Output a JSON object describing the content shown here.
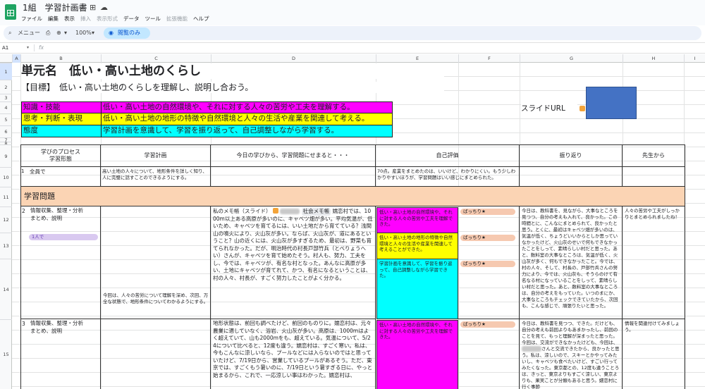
{
  "app": {
    "doc_title": "1組　学習計画書",
    "menus": [
      "ファイル",
      "編集",
      "表示",
      "挿入",
      "表示形式",
      "データ",
      "ツール",
      "拡張機能",
      "ヘルプ"
    ],
    "disabled_menus": [
      3,
      4,
      7
    ],
    "toolbar": {
      "menu_label": "メニュー",
      "zoom": "100%",
      "view_only": "閲覧のみ"
    },
    "cell_ref": "A1",
    "fx": "fx"
  },
  "columns": [
    "A",
    "B",
    "C",
    "D",
    "E",
    "F",
    "G",
    "H",
    "I"
  ],
  "rows": [
    "1",
    "2",
    "3",
    "4",
    "5",
    "6",
    "7",
    "8",
    "9",
    "10",
    "11",
    "12",
    "13",
    "14",
    "15"
  ],
  "sheet": {
    "unit_title": "単元名　低い・高い土地のくらし",
    "goal": "【目標】　低い・高い土地のくらしを理解し、説明し合おう。",
    "objectives": [
      {
        "label": "知識・技能",
        "text": "低い・高い土地の自然環境や、それに対する人々の苦労や工夫を理解する。",
        "color": "#ff00ff"
      },
      {
        "label": "思考・判断・表現",
        "text": "低い・高い土地の地形の特徴や自然環境と人々の生活や産業を関連して考える。",
        "color": "#ffff00"
      },
      {
        "label": "態度",
        "text": "学習計画を意識して、学習を振り返って、自己調整しながら学習する。",
        "color": "#00ffff"
      }
    ],
    "slide_url_label": "スライドURL",
    "headers": {
      "process": "学びのプロセス\n学習形態",
      "plan": "学習計画",
      "summary": "今日の学びから、学習問題にせまると・・・",
      "self_eval": "自己評価",
      "reflection": "振り返り",
      "teacher": "先生から"
    },
    "row10": {
      "process": "全員で",
      "plan": "高い土地の人々について、地形条件を詳しく知り、人に完璧に話すことのできるようにする。",
      "self_eval": "70点。産業をまとめたのは、いいけど、わかりにくい。もう少しわかりやすいほうが、学習問題はいい感じにまとめられた。"
    },
    "section_title": "学習問題",
    "row12": {
      "number": "2",
      "process": "情報収集、整理・分析\nまとめ、説明",
      "chip": "1人で",
      "plan_bottom": "今回は、人々の苦労について理解を深め、次回、万全な状態で、地形条件についてわかるようにする。",
      "memo_prefix": "私のメモ帳（スライド）",
      "memo_chip": "社会メモ帳",
      "memo_text": "嬬恋村では、1000m以上ある高原が多いのに、キャベツ畑が多い。平均気温が、低いため、キャベツを育てるには、いい土地だから育てている？浅間山の噴火により、火山灰が多い。ならば、火山灰が、道にあるということ？山の近くには、火山灰が多すぎるため、最初は、野菜も育てられなかった。だが、明治時代の村長戸部竹兵（とべりょうへい）さんが、キャベツを育て始めたそう。村人も、努力、工夫をし、今では、キャベツが、有名な村となった。あんなに高原が多い、土地にキャベツが育てれて、かつ、有名になるということは、村の人々、村長が、すごく努力したことがよく分かる。",
      "evals": [
        {
          "text": "低い・高い土地の自然環境や、それに対する人々の苦労や工夫を理解できた。",
          "color": "#ff00ff",
          "badge": "ばっちり★"
        },
        {
          "text": "低い・高い土地の地形の特徴や自然環境と人々の生活や産業を関連して考えることができた。",
          "color": "#ffff00",
          "badge": "ばっちり★"
        },
        {
          "text": "学習計画を意識して、学習を振り返って、自己調整しながら学習できた。",
          "color": "#00ffff",
          "badge": "ばっちり★"
        }
      ],
      "reflection": "今日は、教科書を、見ながら、大事なところを見つつ、自分の考えも入れて、良かった。この時間とに、こんなにまとめられて、良かったと思う。とくに、最初はキャベツ畑が多いのは、気温が低く、ちょうどいいからとしか思っていなかったけど、火山灰のせいで何もできなかったことをしって、素晴らしい村だと思った。あと、数料室の大事なところは、気温が低く、火山灰が多く、何もできなかったこと。今では、村の人々、そして、村長の、戸部竹兵さんの努力により、今では、火山灰も、そうらのけて有名なる村になっていることをしって、素晴らしい村だと思った。あと、数料室の大事なところは、自分の考えをもっていた。いつのまにか、大事なところもチェックできていたから、次回も、こんな感じで、頑張りたいと思った。",
      "teacher": "人々の苦労や工夫がしっかりとまとめられましたね！"
    },
    "row15": {
      "number": "3",
      "process": "情報収集、整理・分析\nまとめ、説明",
      "memo_text": "地形状態は、前回も調べたけど、前回のものりに。嬬恋村は、元々農業に適していなく、浴岩、火山灰が多い。高原は、1000mはよく超えていて、山も2000mをも、超えている。気温について、5/24について比べると、12度も違う。嬬恋村は、すごく寒い。私は、今もこんなに涼しいなら、プールなどには入らないのではと思っていたけど、7/19日から、営業しているプールがあるそう。ただ、東京では、すごくもう暑いのに、7/19日という暑すぎる日に、やっと始まるから、これで、一応涼しい事はわかった。嬬恋村は、",
      "eval": {
        "text": "低い・高い土地の自然環境や、それに対する人々の苦労や工夫を理解できた。",
        "color": "#ff00ff",
        "badge": "ばっちり★"
      },
      "reflection_pre": "今日は、教科書を見つつ、できた。だけども、自分の考えも前回よりもあまかったし、前回のことを見て、もっと理解が深まったと思った。今回は、交流ができなかったけども、今回は、",
      "reflection_post": "さんと交流できたから、良かったと思う。私は、涼しいので、スキーとかやってみたいし、キャベツも食べたいけど、すごい行ってみたくなった。東京都との、12度も違うことろは、きっと、東京よりもすごく涼しい、東京よりも、果実ことが分類もあると思う。嬬恋村に行く事節",
      "teacher": "情報を関連付けてみましょう。"
    }
  }
}
